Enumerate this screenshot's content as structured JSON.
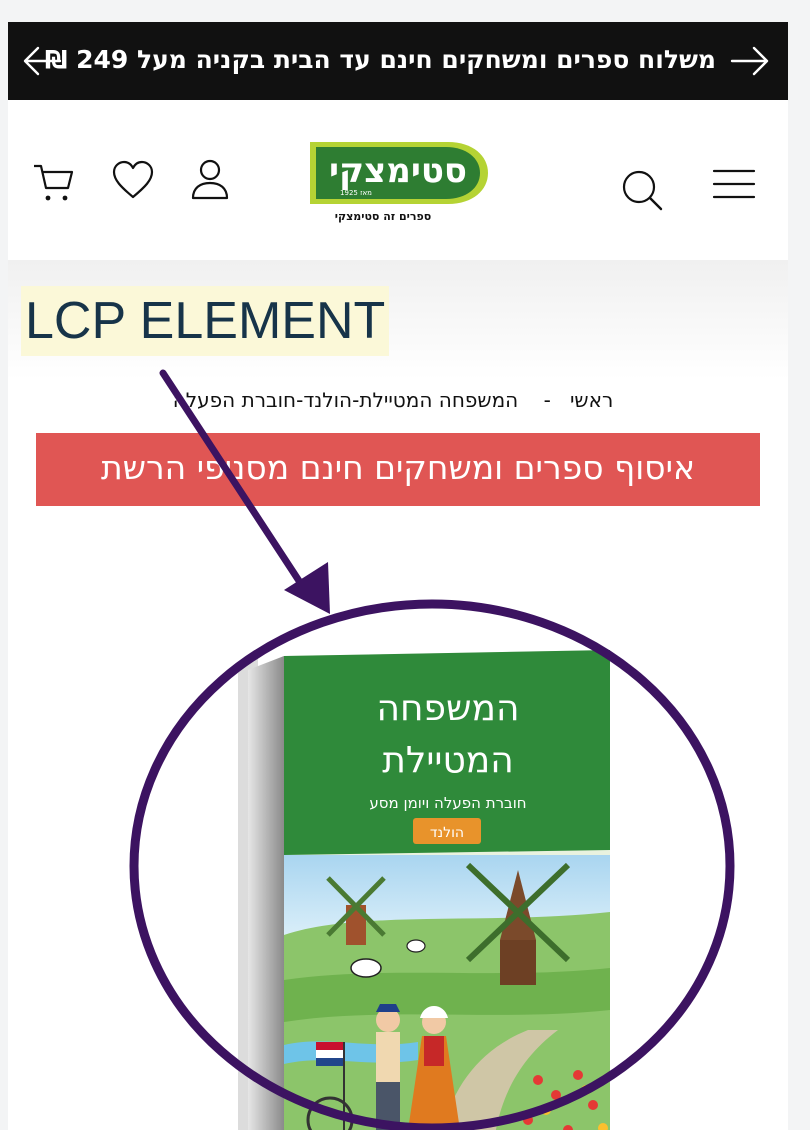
{
  "announcement": {
    "text": "משלוח ספרים ומשחקים חינם עד הבית בקניה מעל 249 ₪",
    "prev_icon": "arrow-left-icon",
    "next_icon": "arrow-right-icon"
  },
  "header": {
    "icons": [
      "menu-icon",
      "search-icon",
      "user-icon",
      "heart-icon",
      "cart-icon"
    ],
    "logo": {
      "name": "סטימצקי",
      "since": "מאז 1925",
      "tagline": "ספרים זה סטימצקי",
      "colors": {
        "green": "#2e7d32",
        "lime": "#b5d334"
      }
    }
  },
  "annotation": {
    "lcp_label": "LCP ELEMENT",
    "color": "#3c1361"
  },
  "breadcrumb": {
    "home": "ראשי",
    "separator": "-",
    "current": "המשפחה המטיילת-הולנד-חוברת הפעלה"
  },
  "promo": {
    "text": "איסוף ספרים ומשחקים חינם מסניפי הרשת",
    "color": "#e05654"
  },
  "product": {
    "title_line1": "המשפחה",
    "title_line2": "המטיילת",
    "subtitle": "חוברת הפעלה ויומן מסע",
    "badge": "הולנד"
  }
}
